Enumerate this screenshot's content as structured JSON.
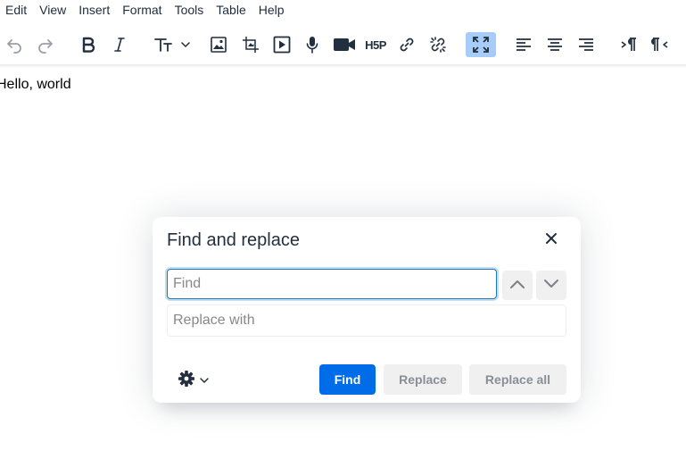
{
  "menubar": {
    "items": [
      "Edit",
      "View",
      "Insert",
      "Format",
      "Tools",
      "Table",
      "Help"
    ]
  },
  "toolbar": {
    "buttons": [
      "undo-icon",
      "redo-icon",
      "bold-icon",
      "italic-icon",
      "text-size-icon",
      "image-icon",
      "crop-icon",
      "media-icon",
      "microphone-icon",
      "video-icon",
      "h5p-icon",
      "link-icon",
      "unlink-icon",
      "fullscreen-icon",
      "align-left-icon",
      "align-center-icon",
      "align-right-icon",
      "ltr-icon",
      "rtl-icon"
    ],
    "h5p_label": "H5P",
    "active_button": "fullscreen-icon",
    "active_color": "#a6ccf7"
  },
  "content": {
    "text": "Hello, world"
  },
  "dialog": {
    "title": "Find and replace",
    "find_placeholder": "Find",
    "find_value": "",
    "replace_placeholder": "Replace with",
    "replace_value": "",
    "buttons": {
      "find": "Find",
      "replace": "Replace",
      "replace_all": "Replace all"
    },
    "primary_color": "#006ce7"
  }
}
